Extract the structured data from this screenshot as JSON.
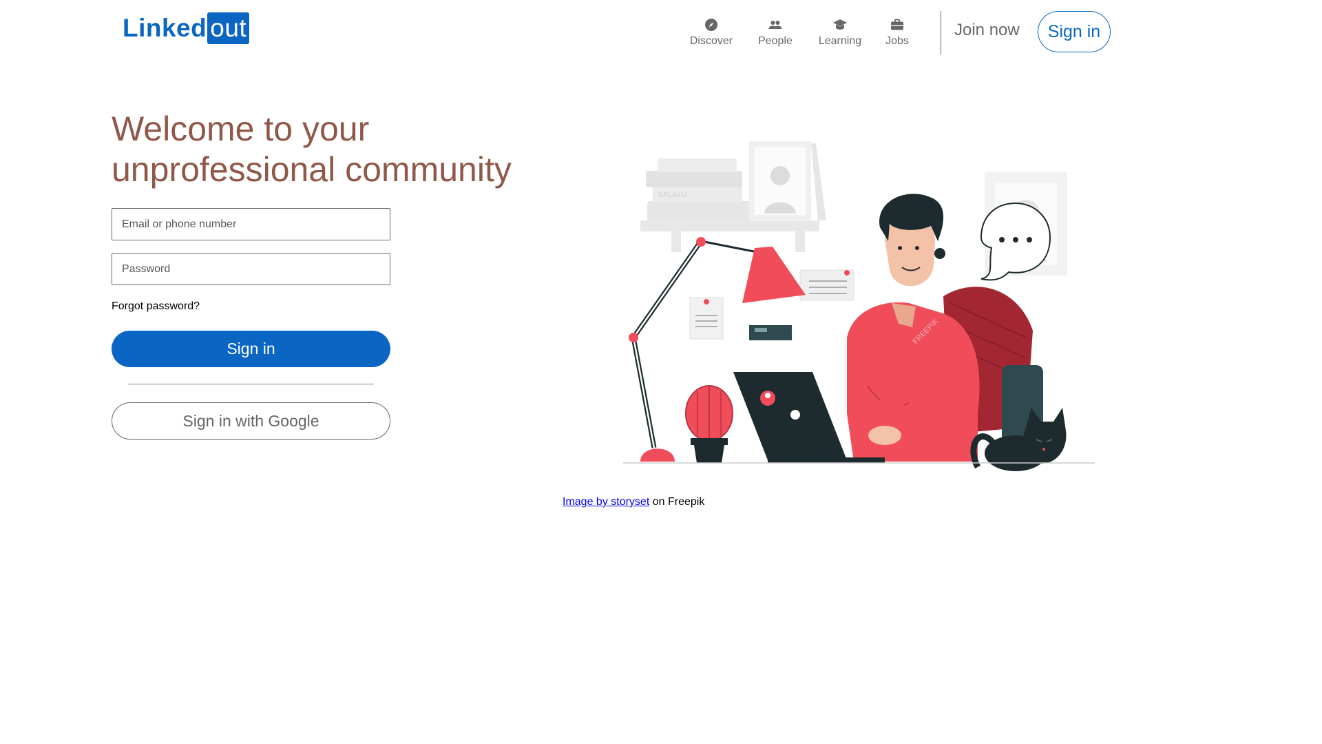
{
  "header": {
    "logo_text": "Linked",
    "logo_box_text": "out",
    "nav": [
      {
        "label": "Discover",
        "icon": "compass-icon"
      },
      {
        "label": "People",
        "icon": "people-icon"
      },
      {
        "label": "Learning",
        "icon": "graduation-cap-icon"
      },
      {
        "label": "Jobs",
        "icon": "briefcase-icon"
      }
    ],
    "join_now": "Join now",
    "sign_in": "Sign in"
  },
  "main": {
    "headline_line1": "Welcome to your",
    "headline_line2": "unprofessional community",
    "email_placeholder": "Email or phone number",
    "password_placeholder": "Password",
    "forgot_password": "Forgot password?",
    "sign_in_button": "Sign in",
    "google_button": "Sign in with Google"
  },
  "illustration": {
    "book_label": "SALAYU",
    "watermark": "FREEPIK"
  },
  "credit": {
    "link_text": "Image by storyset",
    "suffix": " on Freepik"
  },
  "colors": {
    "brand_blue": "#0a66c2",
    "headline": "#8f5849",
    "nav_grey": "#666666",
    "accent_red": "#f04c5a"
  }
}
